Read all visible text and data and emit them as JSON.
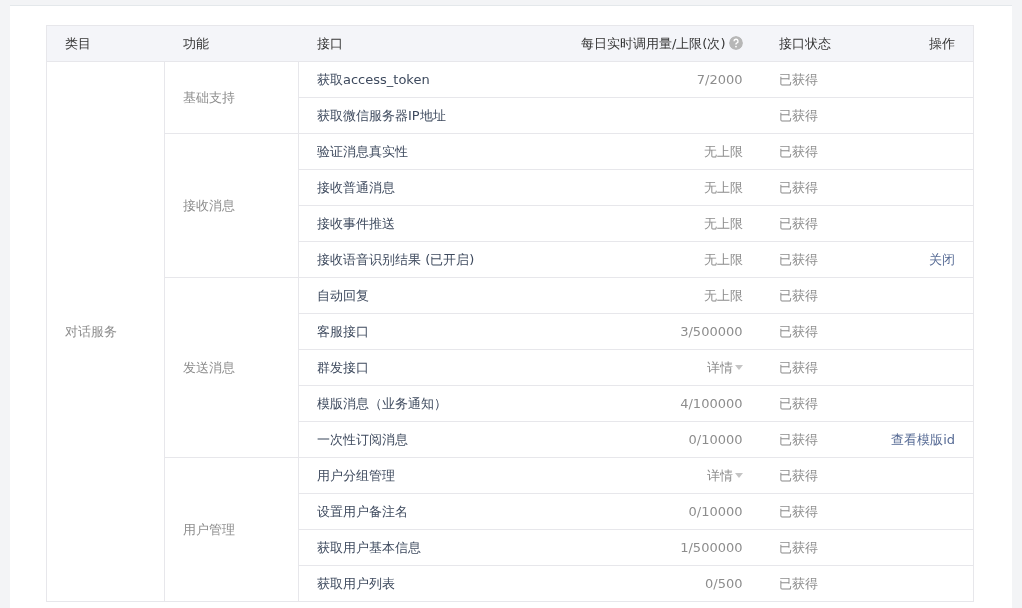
{
  "table": {
    "columns": [
      {
        "label": "类目"
      },
      {
        "label": "功能"
      },
      {
        "label": "接口"
      },
      {
        "label": "每日实时调用量/上限(次)",
        "help": true
      },
      {
        "label": "接口状态"
      },
      {
        "label": "操作"
      }
    ],
    "categories": [
      {
        "name": "对话服务",
        "functions": [
          {
            "name": "基础支持",
            "interfaces": [
              {
                "name": "获取access_token",
                "usage": {
                  "kind": "text",
                  "text": "7/2000"
                },
                "status": "已获得"
              },
              {
                "name": "获取微信服务器IP地址",
                "status": "已获得"
              }
            ]
          },
          {
            "name": "接收消息",
            "interfaces": [
              {
                "name": "验证消息真实性",
                "usage": {
                  "kind": "text",
                  "text": "无上限"
                },
                "status": "已获得"
              },
              {
                "name": "接收普通消息",
                "usage": {
                  "kind": "text",
                  "text": "无上限"
                },
                "status": "已获得"
              },
              {
                "name": "接收事件推送",
                "usage": {
                  "kind": "text",
                  "text": "无上限"
                },
                "status": "已获得"
              },
              {
                "name": "接收语音识别结果 (已开启)",
                "usage": {
                  "kind": "text",
                  "text": "无上限"
                },
                "status": "已获得",
                "action": "关闭"
              }
            ]
          },
          {
            "name": "发送消息",
            "interfaces": [
              {
                "name": "自动回复",
                "usage": {
                  "kind": "text",
                  "text": "无上限"
                },
                "status": "已获得"
              },
              {
                "name": "客服接口",
                "usage": {
                  "kind": "text",
                  "text": "3/500000"
                },
                "status": "已获得"
              },
              {
                "name": "群发接口",
                "usage": {
                  "kind": "dropdown",
                  "text": "详情"
                },
                "status": "已获得"
              },
              {
                "name": "模版消息（业务通知）",
                "usage": {
                  "kind": "text",
                  "text": "4/100000"
                },
                "status": "已获得"
              },
              {
                "name": "一次性订阅消息",
                "usage": {
                  "kind": "text",
                  "text": "0/10000"
                },
                "status": "已获得",
                "action": "查看模版id"
              }
            ]
          },
          {
            "name": "用户管理",
            "interfaces": [
              {
                "name": "用户分组管理",
                "usage": {
                  "kind": "dropdown",
                  "text": "详情"
                },
                "status": "已获得"
              },
              {
                "name": "设置用户备注名",
                "usage": {
                  "kind": "text",
                  "text": "0/10000"
                },
                "status": "已获得"
              },
              {
                "name": "获取用户基本信息",
                "usage": {
                  "kind": "text",
                  "text": "1/500000"
                },
                "status": "已获得"
              },
              {
                "name": "获取用户列表",
                "usage": {
                  "kind": "text",
                  "text": "0/500"
                },
                "status": "已获得"
              }
            ]
          }
        ]
      }
    ]
  }
}
